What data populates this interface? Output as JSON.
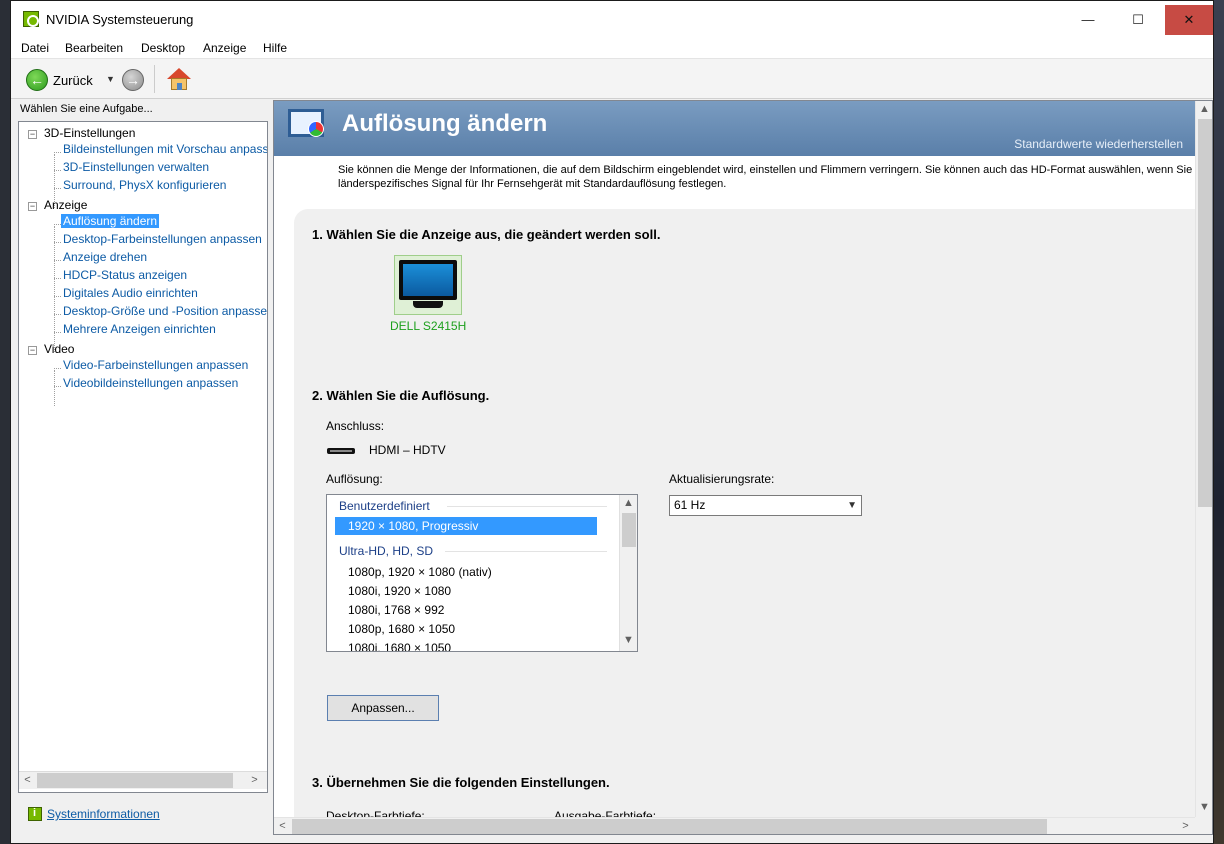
{
  "window": {
    "title": "NVIDIA Systemsteuerung",
    "min_glyph": "—",
    "max_glyph": "☐",
    "close_glyph": "✕"
  },
  "menu": [
    "Datei",
    "Bearbeiten",
    "Desktop",
    "Anzeige",
    "Hilfe"
  ],
  "toolbar": {
    "back_label": "Zurück"
  },
  "sidebar": {
    "task_label": "Wählen Sie eine Aufgabe...",
    "categories": [
      {
        "label": "3D-Einstellungen",
        "items": [
          "Bildeinstellungen mit Vorschau anpass",
          "3D-Einstellungen verwalten",
          "Surround, PhysX konfigurieren"
        ]
      },
      {
        "label": "Anzeige",
        "items": [
          "Auflösung ändern",
          "Desktop-Farbeinstellungen anpassen",
          "Anzeige drehen",
          "HDCP-Status anzeigen",
          "Digitales Audio einrichten",
          "Desktop-Größe und -Position anpasse",
          "Mehrere Anzeigen einrichten"
        ]
      },
      {
        "label": "Video",
        "items": [
          "Video-Farbeinstellungen anpassen",
          "Videobildeinstellungen anpassen"
        ]
      }
    ],
    "selected_item": "Auflösung ändern",
    "sysinfo_link": "Systeminformationen"
  },
  "page": {
    "title": "Auflösung ändern",
    "restore_defaults": "Standardwerte wiederherstellen",
    "intro_line1": "Sie können die Menge der Informationen, die auf dem Bildschirm eingeblendet wird, einstellen und Flimmern verringern. Sie können auch das HD-Format auswählen, wenn Sie ein HD",
    "intro_line2": "länderspezifisches Signal für Ihr Fernsehgerät mit Standardauflösung festlegen.",
    "step1": "1. Wählen Sie die Anzeige aus, die geändert werden soll.",
    "display_name": "DELL S2415H",
    "step2": "2. Wählen Sie die Auflösung.",
    "connection_label": "Anschluss:",
    "connection_value": "HDMI – HDTV",
    "resolution_label": "Auflösung:",
    "refresh_label": "Aktualisierungsrate:",
    "refresh_value": "61 Hz",
    "resolution_groups": [
      {
        "name": "Benutzerdefiniert",
        "items": [
          "1920 × 1080, Progressiv"
        ]
      },
      {
        "name": "Ultra-HD, HD, SD",
        "items": [
          "1080p, 1920 × 1080 (nativ)",
          "1080i, 1920 × 1080",
          "1080i, 1768 × 992",
          "1080p, 1680 × 1050",
          "1080i, 1680 × 1050"
        ]
      }
    ],
    "selected_resolution": "1920 × 1080, Progressiv",
    "customize_button": "Anpassen...",
    "step3": "3. Übernehmen Sie die folgenden Einstellungen.",
    "col_left_cut": "Desktop-Farbtiefe:",
    "col_right_cut": "Ausgabe-Farbtiefe:"
  }
}
